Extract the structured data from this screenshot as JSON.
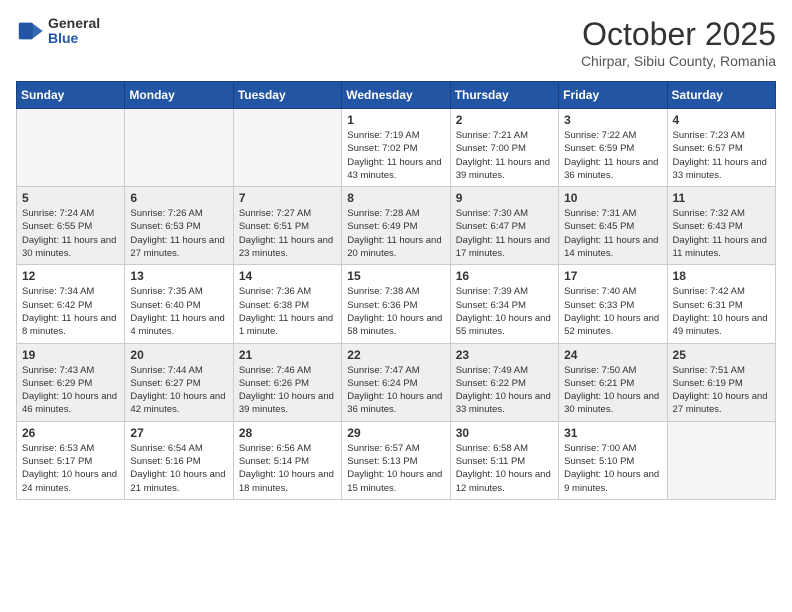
{
  "header": {
    "logo_general": "General",
    "logo_blue": "Blue",
    "month_title": "October 2025",
    "subtitle": "Chirpar, Sibiu County, Romania"
  },
  "weekdays": [
    "Sunday",
    "Monday",
    "Tuesday",
    "Wednesday",
    "Thursday",
    "Friday",
    "Saturday"
  ],
  "weeks": [
    [
      {
        "day": "",
        "empty": true
      },
      {
        "day": "",
        "empty": true
      },
      {
        "day": "",
        "empty": true
      },
      {
        "day": "1",
        "sunrise": "7:19 AM",
        "sunset": "7:02 PM",
        "daylight": "11 hours and 43 minutes."
      },
      {
        "day": "2",
        "sunrise": "7:21 AM",
        "sunset": "7:00 PM",
        "daylight": "11 hours and 39 minutes."
      },
      {
        "day": "3",
        "sunrise": "7:22 AM",
        "sunset": "6:59 PM",
        "daylight": "11 hours and 36 minutes."
      },
      {
        "day": "4",
        "sunrise": "7:23 AM",
        "sunset": "6:57 PM",
        "daylight": "11 hours and 33 minutes."
      }
    ],
    [
      {
        "day": "5",
        "sunrise": "7:24 AM",
        "sunset": "6:55 PM",
        "daylight": "11 hours and 30 minutes."
      },
      {
        "day": "6",
        "sunrise": "7:26 AM",
        "sunset": "6:53 PM",
        "daylight": "11 hours and 27 minutes."
      },
      {
        "day": "7",
        "sunrise": "7:27 AM",
        "sunset": "6:51 PM",
        "daylight": "11 hours and 23 minutes."
      },
      {
        "day": "8",
        "sunrise": "7:28 AM",
        "sunset": "6:49 PM",
        "daylight": "11 hours and 20 minutes."
      },
      {
        "day": "9",
        "sunrise": "7:30 AM",
        "sunset": "6:47 PM",
        "daylight": "11 hours and 17 minutes."
      },
      {
        "day": "10",
        "sunrise": "7:31 AM",
        "sunset": "6:45 PM",
        "daylight": "11 hours and 14 minutes."
      },
      {
        "day": "11",
        "sunrise": "7:32 AM",
        "sunset": "6:43 PM",
        "daylight": "11 hours and 11 minutes."
      }
    ],
    [
      {
        "day": "12",
        "sunrise": "7:34 AM",
        "sunset": "6:42 PM",
        "daylight": "11 hours and 8 minutes."
      },
      {
        "day": "13",
        "sunrise": "7:35 AM",
        "sunset": "6:40 PM",
        "daylight": "11 hours and 4 minutes."
      },
      {
        "day": "14",
        "sunrise": "7:36 AM",
        "sunset": "6:38 PM",
        "daylight": "11 hours and 1 minute."
      },
      {
        "day": "15",
        "sunrise": "7:38 AM",
        "sunset": "6:36 PM",
        "daylight": "10 hours and 58 minutes."
      },
      {
        "day": "16",
        "sunrise": "7:39 AM",
        "sunset": "6:34 PM",
        "daylight": "10 hours and 55 minutes."
      },
      {
        "day": "17",
        "sunrise": "7:40 AM",
        "sunset": "6:33 PM",
        "daylight": "10 hours and 52 minutes."
      },
      {
        "day": "18",
        "sunrise": "7:42 AM",
        "sunset": "6:31 PM",
        "daylight": "10 hours and 49 minutes."
      }
    ],
    [
      {
        "day": "19",
        "sunrise": "7:43 AM",
        "sunset": "6:29 PM",
        "daylight": "10 hours and 46 minutes."
      },
      {
        "day": "20",
        "sunrise": "7:44 AM",
        "sunset": "6:27 PM",
        "daylight": "10 hours and 42 minutes."
      },
      {
        "day": "21",
        "sunrise": "7:46 AM",
        "sunset": "6:26 PM",
        "daylight": "10 hours and 39 minutes."
      },
      {
        "day": "22",
        "sunrise": "7:47 AM",
        "sunset": "6:24 PM",
        "daylight": "10 hours and 36 minutes."
      },
      {
        "day": "23",
        "sunrise": "7:49 AM",
        "sunset": "6:22 PM",
        "daylight": "10 hours and 33 minutes."
      },
      {
        "day": "24",
        "sunrise": "7:50 AM",
        "sunset": "6:21 PM",
        "daylight": "10 hours and 30 minutes."
      },
      {
        "day": "25",
        "sunrise": "7:51 AM",
        "sunset": "6:19 PM",
        "daylight": "10 hours and 27 minutes."
      }
    ],
    [
      {
        "day": "26",
        "sunrise": "6:53 AM",
        "sunset": "5:17 PM",
        "daylight": "10 hours and 24 minutes."
      },
      {
        "day": "27",
        "sunrise": "6:54 AM",
        "sunset": "5:16 PM",
        "daylight": "10 hours and 21 minutes."
      },
      {
        "day": "28",
        "sunrise": "6:56 AM",
        "sunset": "5:14 PM",
        "daylight": "10 hours and 18 minutes."
      },
      {
        "day": "29",
        "sunrise": "6:57 AM",
        "sunset": "5:13 PM",
        "daylight": "10 hours and 15 minutes."
      },
      {
        "day": "30",
        "sunrise": "6:58 AM",
        "sunset": "5:11 PM",
        "daylight": "10 hours and 12 minutes."
      },
      {
        "day": "31",
        "sunrise": "7:00 AM",
        "sunset": "5:10 PM",
        "daylight": "10 hours and 9 minutes."
      },
      {
        "day": "",
        "empty": true
      }
    ]
  ]
}
